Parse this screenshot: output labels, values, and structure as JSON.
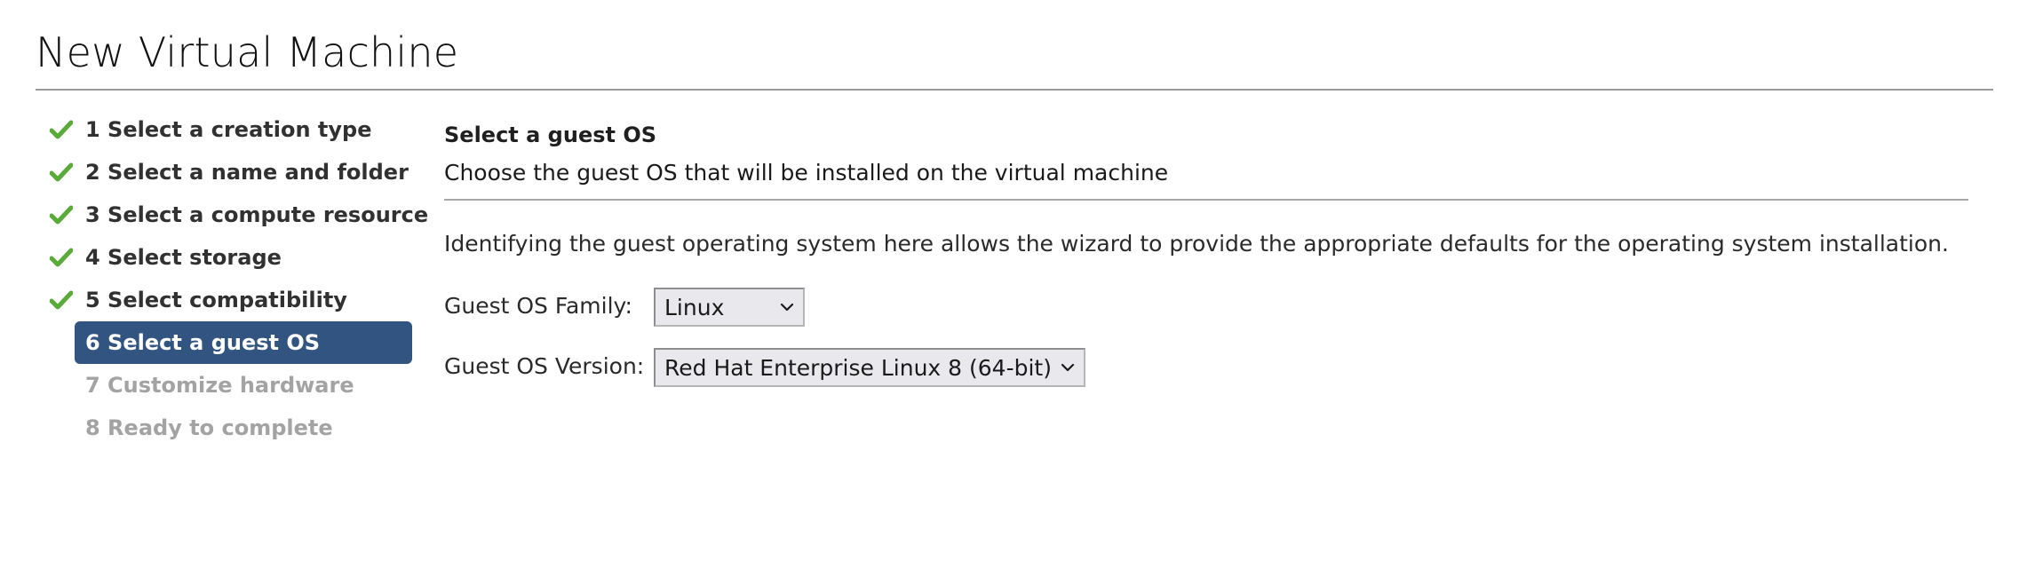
{
  "window": {
    "title": "New Virtual Machine"
  },
  "wizard": {
    "steps": [
      {
        "label": "1 Select a creation type",
        "state": "complete"
      },
      {
        "label": "2 Select a name and folder",
        "state": "complete"
      },
      {
        "label": "3 Select a compute resource",
        "state": "complete"
      },
      {
        "label": "4 Select storage",
        "state": "complete"
      },
      {
        "label": "5 Select compatibility",
        "state": "complete"
      },
      {
        "label": "6 Select a guest OS",
        "state": "active"
      },
      {
        "label": "7 Customize hardware",
        "state": "pending"
      },
      {
        "label": "8 Ready to complete",
        "state": "pending"
      }
    ]
  },
  "main": {
    "heading": "Select a guest OS",
    "subheading": "Choose the guest OS that will be installed on the virtual machine",
    "description": "Identifying the guest operating system here allows the wizard to provide the appropriate defaults for the operating system installation.",
    "family": {
      "label": "Guest OS Family:",
      "value": "Linux"
    },
    "version": {
      "label": "Guest OS Version:",
      "value": "Red Hat Enterprise Linux 8 (64-bit)"
    }
  },
  "colors": {
    "active_step_bg": "#325480",
    "check_green": "#5aaa3a",
    "pending_text": "#a3a3a3"
  },
  "icons": {
    "complete": "check-icon",
    "dropdown": "chevron-down-icon"
  }
}
